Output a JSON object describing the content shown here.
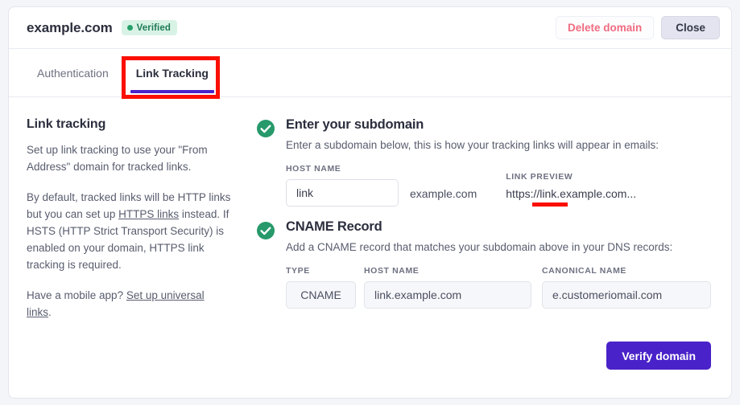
{
  "header": {
    "domain": "example.com",
    "badge": {
      "label": "Verified",
      "dot_color": "#27a06b",
      "bg_color": "#d8f3e5"
    },
    "delete_label": "Delete domain",
    "close_label": "Close"
  },
  "tabs": [
    {
      "label": "Authentication",
      "active": false
    },
    {
      "label": "Link Tracking",
      "active": true
    }
  ],
  "left": {
    "title": "Link tracking",
    "p1": "Set up link tracking to use your \"From Address\" domain for tracked links.",
    "p2_before": "By default, tracked links will be HTTP links but you can set up ",
    "p2_link": "HTTPS links",
    "p2_after": " instead. If HSTS (HTTP Strict Transport Security) is enabled on your domain, HTTPS link tracking is required.",
    "p3_before": "Have a mobile app? ",
    "p3_link": "Set up universal links",
    "p3_after": "."
  },
  "steps": [
    {
      "title": "Enter your subdomain",
      "desc": "Enter a subdomain below, this is how your tracking links will appear in emails:",
      "icon": "check-circle-icon",
      "host_label": "HOST NAME",
      "host_value": "link",
      "host_placeholder": "link",
      "domain_suffix": "example.com",
      "preview_label": "LINK PREVIEW",
      "preview_value": "https://link.example.com..."
    },
    {
      "title": "CNAME Record",
      "desc": "Add a CNAME record that matches your subdomain above in your DNS records:",
      "icon": "check-circle-icon",
      "type_label": "TYPE",
      "type_value": "CNAME",
      "host_label": "HOST NAME",
      "host_value": "link.example.com",
      "canonical_label": "CANONICAL NAME",
      "canonical_value": "e.customeriomail.com"
    }
  ],
  "footer": {
    "verify_label": "Verify domain"
  },
  "colors": {
    "accent_purple": "#4a22c9",
    "success_green": "#27996a",
    "danger_red": "#f06c80",
    "annotation_red": "#fa0f00"
  }
}
